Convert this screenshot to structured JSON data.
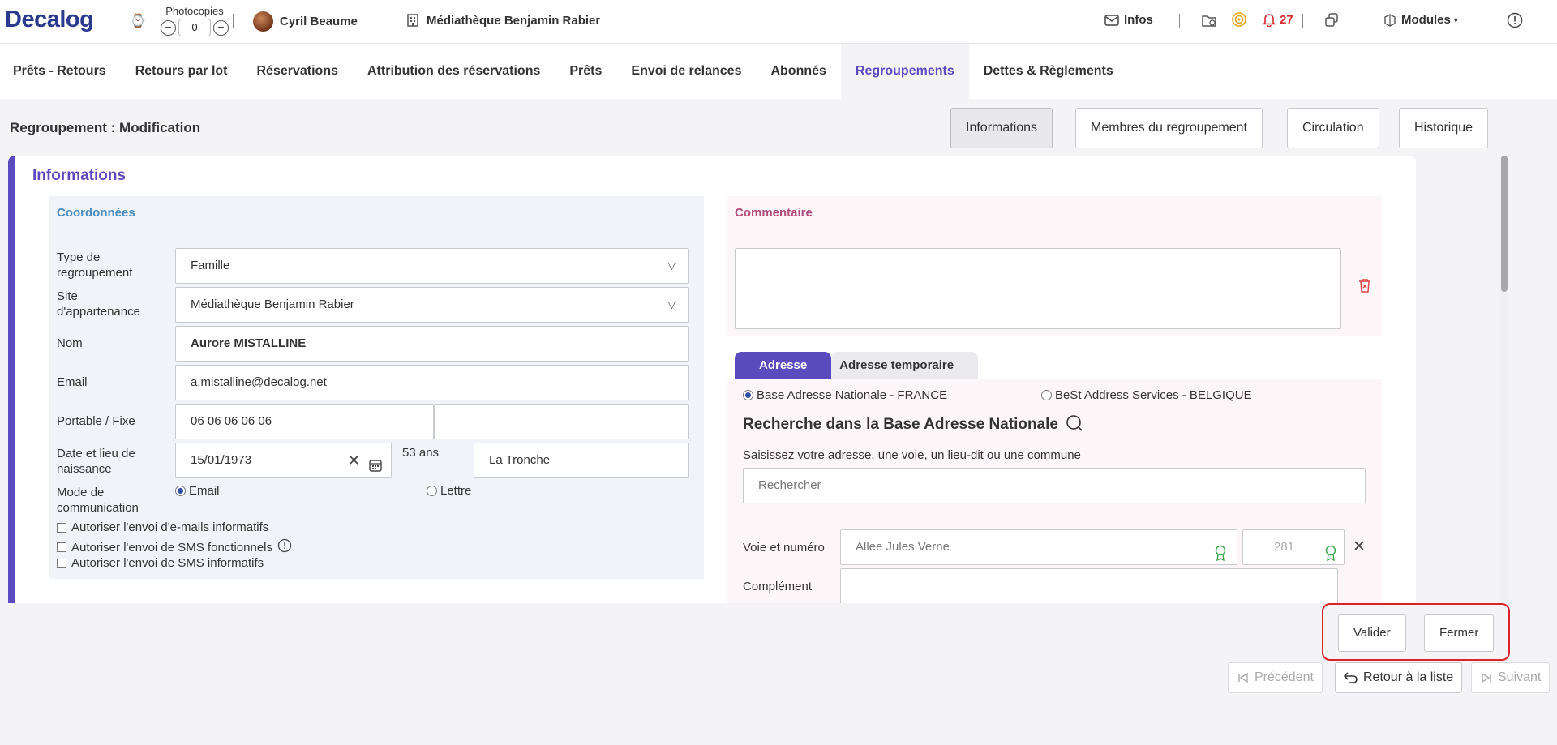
{
  "topbar": {
    "logo": "Decalog",
    "photocopies_label": "Photocopies",
    "photocopies_value": "0",
    "user_name": "Cyril Beaume",
    "site_name": "Médiathèque Benjamin Rabier",
    "infos_label": "Infos",
    "notification_count": "27",
    "modules_label": "Modules"
  },
  "nav": {
    "tabs": [
      "Prêts - Retours",
      "Retours par lot",
      "Réservations",
      "Attribution des réservations",
      "Prêts",
      "Envoi de relances",
      "Abonnés",
      "Regroupements",
      "Dettes & Règlements"
    ],
    "active": "Regroupements"
  },
  "page": {
    "title": "Regroupement : Modification",
    "section_buttons": [
      "Informations",
      "Membres du regroupement",
      "Circulation",
      "Historique"
    ]
  },
  "card": {
    "title": "Informations",
    "coordonnees": {
      "title": "Coordonnées",
      "type_label": "Type de regroupement",
      "type_value": "Famille",
      "site_label": "Site d'appartenance",
      "site_value": "Médiathèque Benjamin Rabier",
      "nom_label": "Nom",
      "nom_value": "Aurore MISTALLINE",
      "email_label": "Email",
      "email_value": "a.mistalline@decalog.net",
      "phone_label": "Portable / Fixe",
      "mobile_value": "06 06 06 06 06",
      "fixe_value": "",
      "birth_label": "Date et lieu de naissance",
      "birth_date": "15/01/1973",
      "age": "53 ans",
      "birth_place": "La Tronche",
      "comm_label": "Mode de communication",
      "comm_email": "Email",
      "comm_lettre": "Lettre",
      "chk_emails": "Autoriser l'envoi d'e-mails informatifs",
      "chk_sms_fonc": "Autoriser l'envoi de SMS fonctionnels",
      "chk_sms_info": "Autoriser l'envoi de SMS informatifs"
    },
    "commentaire": {
      "title": "Commentaire",
      "value": ""
    },
    "adresse": {
      "tab_active": "Adresse",
      "tab_temp": "Adresse temporaire",
      "radio_france": "Base Adresse Nationale - FRANCE",
      "radio_belgique": "BeSt Address Services - BELGIQUE",
      "search_heading": "Recherche dans la Base Adresse Nationale",
      "search_hint": "Saisissez votre adresse, une voie, un lieu-dit ou une commune",
      "search_placeholder": "Rechercher",
      "voie_label": "Voie et numéro",
      "voie_value": "Allee Jules Verne",
      "numero_value": "281",
      "complement_label": "Complément"
    }
  },
  "actions": {
    "valider": "Valider",
    "fermer": "Fermer",
    "precedent": "Précédent",
    "retour": "Retour à la liste",
    "suivant": "Suivant"
  }
}
